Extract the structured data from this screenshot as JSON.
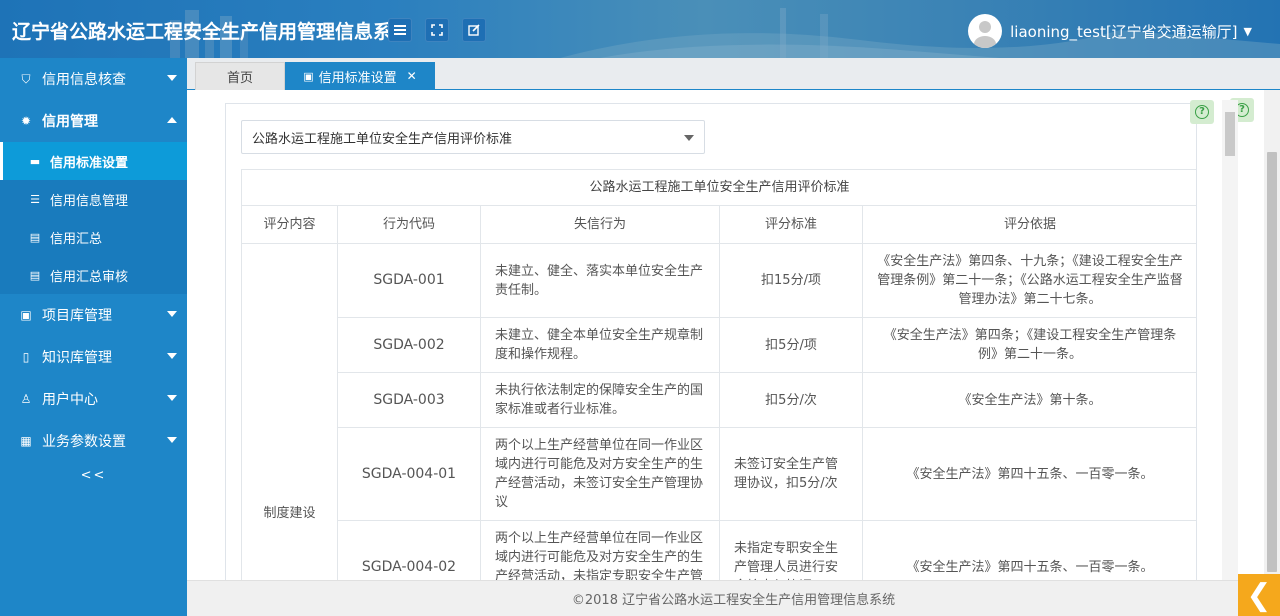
{
  "header": {
    "title": "辽宁省公路水运工程安全生产信用管理信息系统",
    "user_label": "liaoning_test[辽宁省交通运输厅]"
  },
  "sidebar": {
    "items": [
      {
        "label": "信用信息核查",
        "icon": "shield-icon"
      },
      {
        "label": "信用管理",
        "icon": "gear-icon"
      },
      {
        "label": "项目库管理",
        "icon": "image-icon"
      },
      {
        "label": "知识库管理",
        "icon": "book-icon"
      },
      {
        "label": "用户中心",
        "icon": "user-icon"
      },
      {
        "label": "业务参数设置",
        "icon": "grid-icon"
      }
    ],
    "sub_items": [
      {
        "label": "信用标准设置",
        "icon": "card-icon"
      },
      {
        "label": "信用信息管理",
        "icon": "list-icon"
      },
      {
        "label": "信用汇总",
        "icon": "doc-icon"
      },
      {
        "label": "信用汇总审核",
        "icon": "doc-icon"
      }
    ],
    "collapse_label": "<<"
  },
  "tabs": {
    "home": "首页",
    "active": "信用标准设置"
  },
  "select": {
    "value": "公路水运工程施工单位安全生产信用评价标准"
  },
  "table": {
    "caption": "公路水运工程施工单位安全生产信用评价标准",
    "headers": [
      "评分内容",
      "行为代码",
      "失信行为",
      "评分标准",
      "评分依据"
    ],
    "group": "制度建设",
    "rows": [
      {
        "code": "SGDA-001",
        "behavior": "未建立、健全、落实本单位安全生产责任制。",
        "standard": "扣15分/项",
        "basis": "《安全生产法》第四条、十九条；《建设工程安全生产管理条例》第二十一条；《公路水运工程安全生产监督管理办法》第二十七条。"
      },
      {
        "code": "SGDA-002",
        "behavior": "未建立、健全本单位安全生产规章制度和操作规程。",
        "standard": "扣5分/项",
        "basis": "《安全生产法》第四条；《建设工程安全生产管理条例》第二十一条。"
      },
      {
        "code": "SGDA-003",
        "behavior": "未执行依法制定的保障安全生产的国家标准或者行业标准。",
        "standard": "扣5分/次",
        "basis": "《安全生产法》第十条。"
      },
      {
        "code": "SGDA-004-01",
        "behavior": "两个以上生产经营单位在同一作业区域内进行可能危及对方安全生产的生产经营活动，未签订安全生产管理协议",
        "standard": "未签订安全生产管理协议，扣5分/次",
        "basis": "《安全生产法》第四十五条、一百零一条。"
      },
      {
        "code": "SGDA-004-02",
        "behavior": "两个以上生产经营单位在同一作业区域内进行可能危及对方安全生产的生产经营活动，未指定专职安全生产管理人员进行安全检查与协调",
        "standard": "未指定专职安全生产管理人员进行安全检查与协调[",
        "basis": "《安全生产法》第四十五条、一百零一条。"
      }
    ]
  },
  "footer": {
    "copyright": "©2018 辽宁省公路水运工程安全生产信用管理信息系统"
  },
  "colors": {
    "sidebar": "#1e86c8",
    "active_sub": "#0d9bd9",
    "back_button": "#f5a81c"
  }
}
